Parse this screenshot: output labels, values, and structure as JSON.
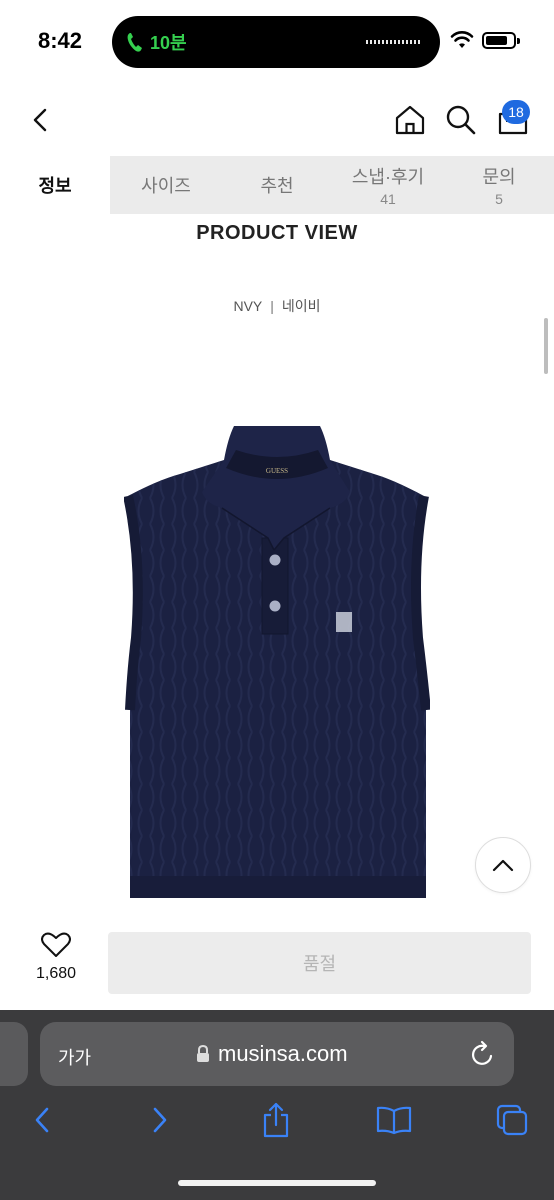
{
  "status_bar": {
    "time": "8:42",
    "call_duration": "10분",
    "battery_level": 0.8
  },
  "nav": {
    "cart_count": "18"
  },
  "tabs": [
    {
      "label": "정보",
      "count": ""
    },
    {
      "label": "사이즈",
      "count": ""
    },
    {
      "label": "추천",
      "count": ""
    },
    {
      "label": "스냅·후기",
      "count": "41"
    },
    {
      "label": "문의",
      "count": "5"
    }
  ],
  "content": {
    "section_title": "PRODUCT VIEW",
    "color_code": "NVY",
    "color_separator": "|",
    "color_name": "네이비",
    "collar_label_text": "GUESS"
  },
  "purchase": {
    "like_count": "1,680",
    "soldout_label": "품절"
  },
  "browser": {
    "text_size_label": "가가",
    "url": "musinsa.com"
  },
  "colors": {
    "accent": "#1f6ae0",
    "garment": "#1b2142",
    "safari_blue": "#3a82f7"
  }
}
